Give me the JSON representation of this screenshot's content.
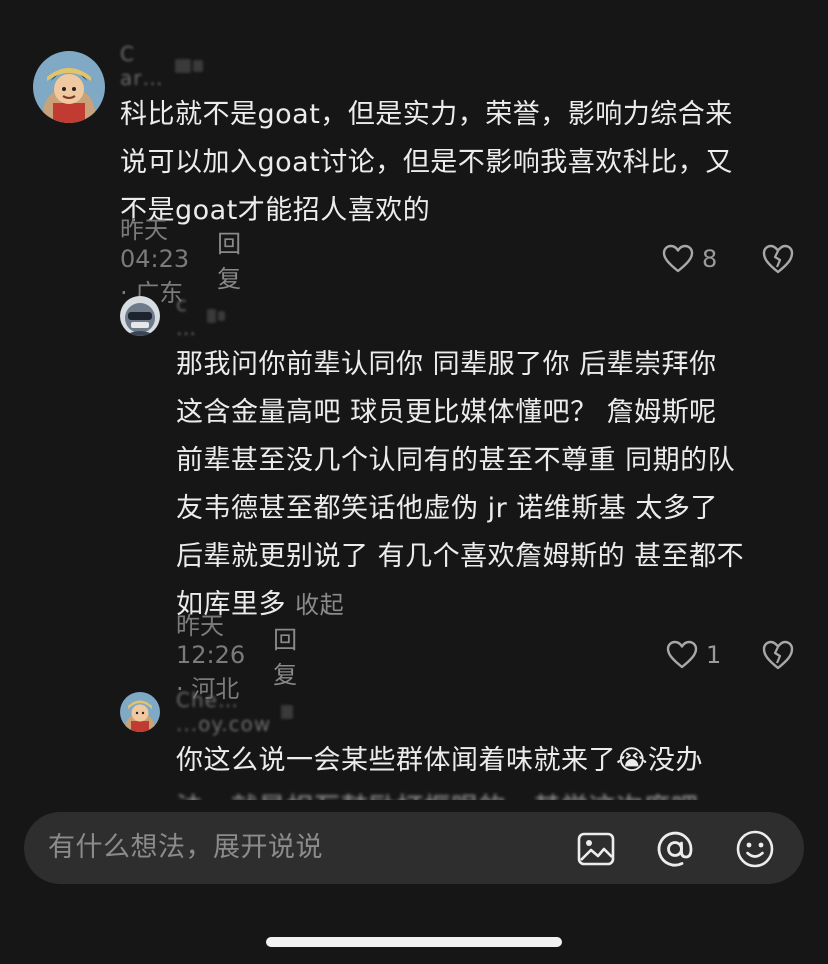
{
  "comments": [
    {
      "username": "C  ar…",
      "text_lines": [
        "科比就不是goat，但是实力，荣誉，影响力综合来",
        "说可以加入goat讨论，但是不影响我喜欢科比，又",
        "不是goat才能招人喜欢的"
      ],
      "time_location": "昨天 04:23 · 广东",
      "reply_label": "回复",
      "likes": "8",
      "avatar_icon": "anime-avatar-icon"
    },
    {
      "username": "c  …",
      "text_lines": [
        "那我问你前辈认同你 同辈服了你  后辈崇拜你",
        "这含金量高吧 球员更比媒体懂吧？  詹姆斯呢",
        "前辈甚至没几个认同有的甚至不尊重  同期的队",
        "友韦德甚至都笑话他虚伪  jr  诺维斯基 太多了",
        "后辈就更别说了 有几个喜欢詹姆斯的 甚至都不",
        "如库里多"
      ],
      "collapse_label": "收起",
      "time_location": "昨天 12:26 · 河北",
      "reply_label": "回复",
      "likes": "1",
      "avatar_icon": "masked-avatar-icon"
    },
    {
      "username": "Che… ...oy.cow",
      "text_lines": [
        "你这么说一会某些群体闻着味就来了😭没办",
        "法，就是相互鼓励打框眼的，其学这次度吧"
      ],
      "avatar_icon": "anime-avatar-icon"
    }
  ],
  "input_bar": {
    "placeholder": "有什么想法，展开说说",
    "icons": [
      "image-icon",
      "at-mention-icon",
      "emoji-icon"
    ]
  },
  "colors": {
    "background": "#161616",
    "text": "#ececec",
    "muted": "#7b7b7b",
    "input_bg": "#2e2e2e"
  }
}
